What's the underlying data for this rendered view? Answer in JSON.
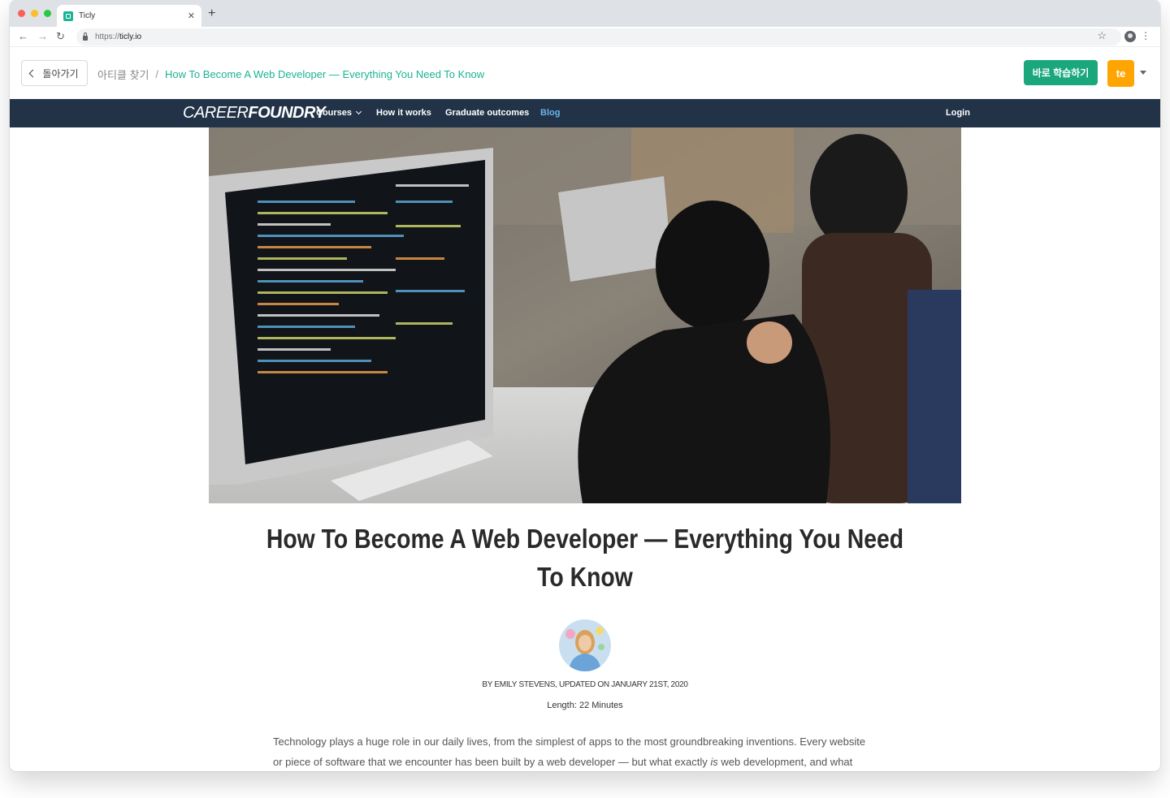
{
  "browser": {
    "tab_title": "Ticly",
    "url_scheme": "https://",
    "url_host": "ticly.io"
  },
  "header": {
    "back_label": "돌아가기",
    "breadcrumb_parent": "아티클 찾기",
    "breadcrumb_separator": "/",
    "breadcrumb_current": "How To Become A Web Developer — Everything You Need To Know",
    "learn_button": "바로 학습하기",
    "user_initials": "te",
    "accent_color": "#1aa77c",
    "avatar_color": "#ffa502"
  },
  "site_nav": {
    "logo_thin": "CAREER",
    "logo_bold": "FOUNDRY",
    "items": [
      {
        "label": "Courses"
      },
      {
        "label": "How it works"
      },
      {
        "label": "Graduate outcomes"
      },
      {
        "label": "Blog"
      }
    ],
    "login": "Login",
    "bg_color": "#223348"
  },
  "article": {
    "title": "How To Become A Web Developer — Everything You Need To Know",
    "byline": "BY EMILY STEVENS, UPDATED ON JANUARY 21ST, 2020",
    "length": "Length: 22 Minutes",
    "body_line1": "Technology plays a huge role in our daily lives, from the simplest of apps to the most groundbreaking inventions. Every website",
    "body_line2_a": "or piece of software that we encounter has been built by a web developer — but what exactly ",
    "body_line2_em": "is",
    "body_line2_b": " web development, and what"
  }
}
